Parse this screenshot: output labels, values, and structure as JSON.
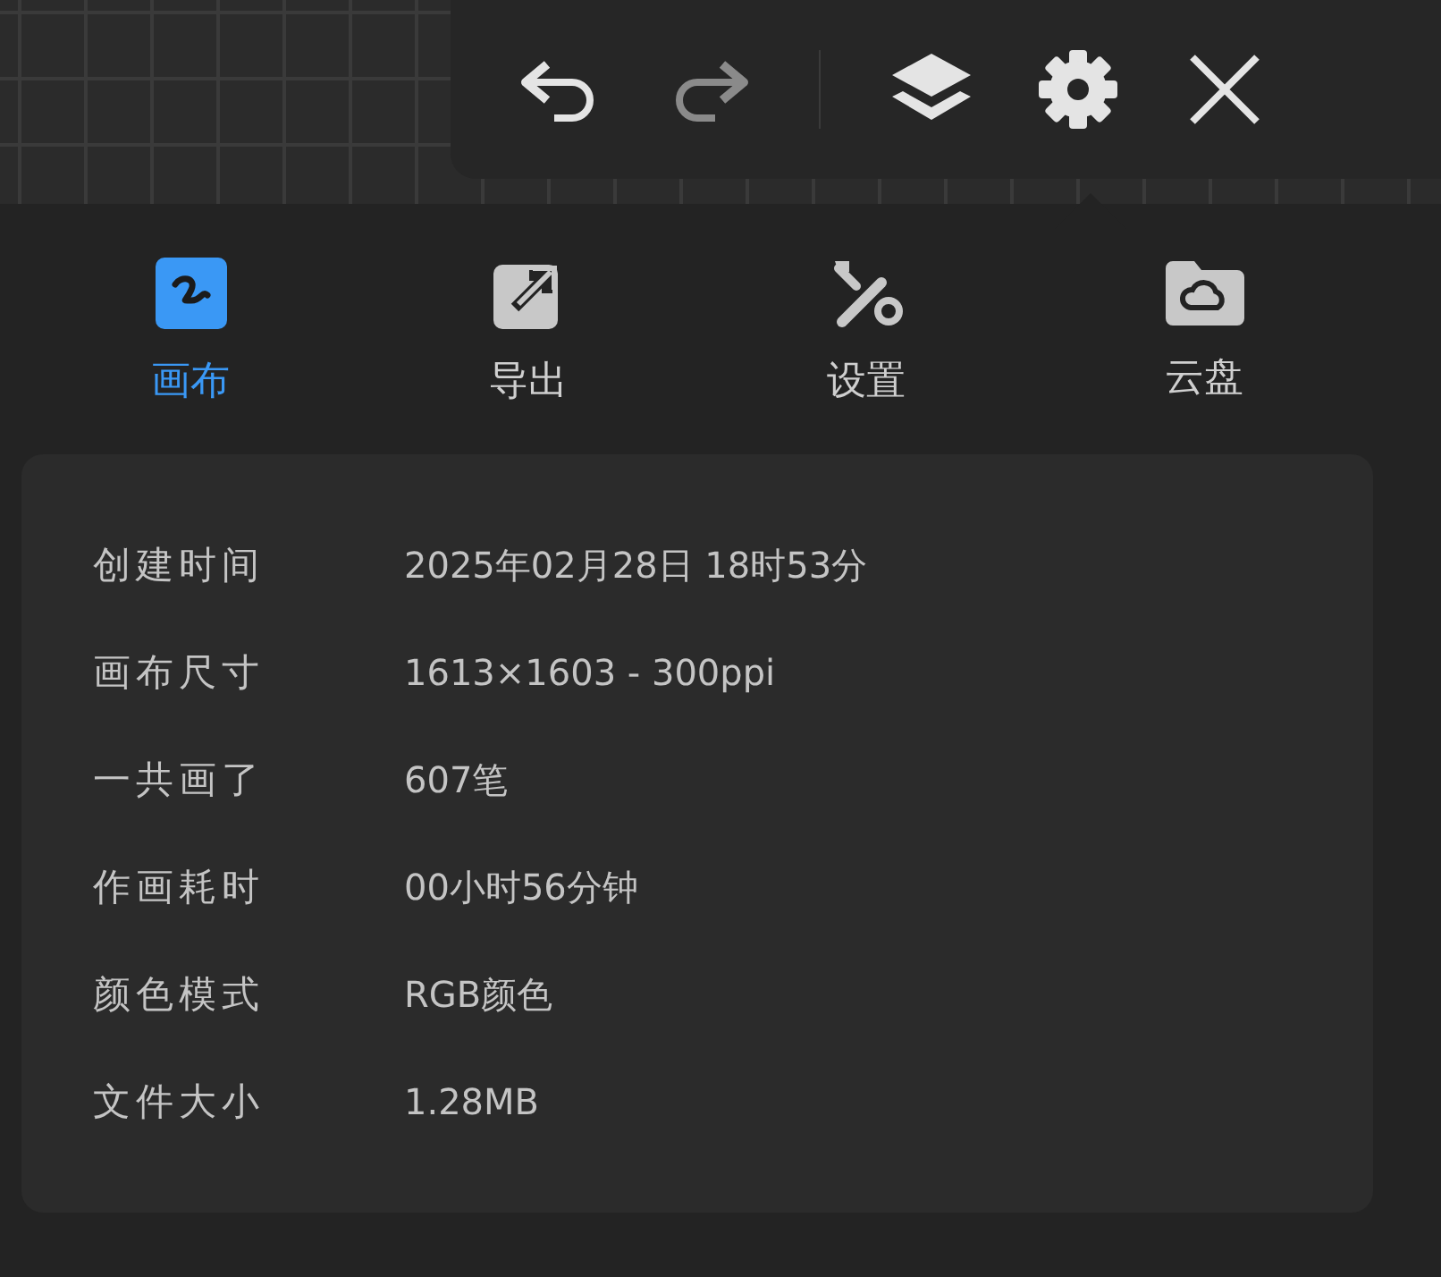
{
  "toolbar": [
    {
      "kind": "undo",
      "disabled": false
    },
    {
      "kind": "redo",
      "disabled": true
    },
    {
      "kind": "layers",
      "disabled": false
    },
    {
      "kind": "settings",
      "disabled": false
    },
    {
      "kind": "close",
      "disabled": false
    }
  ],
  "tabs": [
    {
      "kind": "canvas",
      "label": "画布",
      "selected": true
    },
    {
      "kind": "export",
      "label": "导出",
      "selected": false
    },
    {
      "kind": "tools",
      "label": "设置",
      "selected": false
    },
    {
      "kind": "cloud",
      "label": "云盘",
      "selected": false
    }
  ],
  "info": [
    {
      "label": "创建时间",
      "value": "2025年02月28日 18时53分"
    },
    {
      "label": "画布尺寸",
      "value": "1613×1603 - 300ppi"
    },
    {
      "label": "一共画了",
      "value": "607笔"
    },
    {
      "label": "作画耗时",
      "value": "00小时56分钟"
    },
    {
      "label": "颜色模式",
      "value": "RGB颜色"
    },
    {
      "label": "文件大小",
      "value": "1.28MB"
    }
  ]
}
